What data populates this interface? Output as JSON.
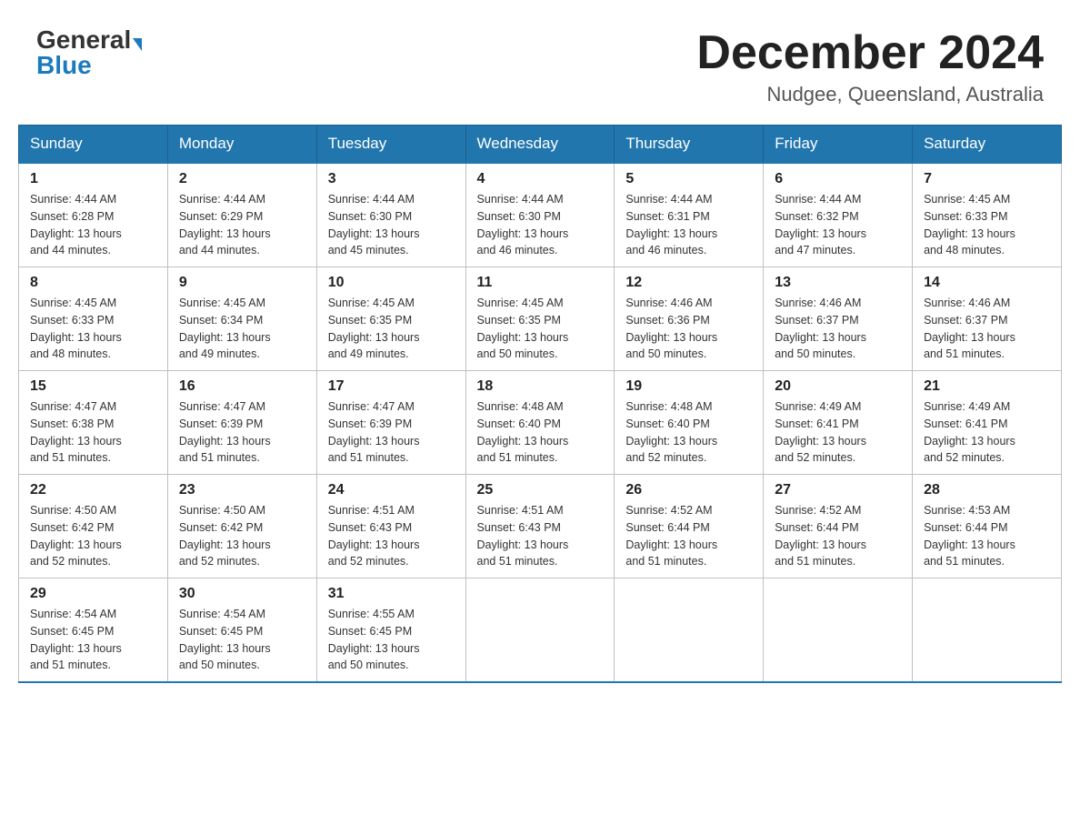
{
  "header": {
    "logo_general": "General",
    "logo_blue": "Blue",
    "month_title": "December 2024",
    "location": "Nudgee, Queensland, Australia"
  },
  "days_of_week": [
    "Sunday",
    "Monday",
    "Tuesday",
    "Wednesday",
    "Thursday",
    "Friday",
    "Saturday"
  ],
  "weeks": [
    [
      {
        "day": "1",
        "sunrise": "4:44 AM",
        "sunset": "6:28 PM",
        "daylight": "13 hours and 44 minutes."
      },
      {
        "day": "2",
        "sunrise": "4:44 AM",
        "sunset": "6:29 PM",
        "daylight": "13 hours and 44 minutes."
      },
      {
        "day": "3",
        "sunrise": "4:44 AM",
        "sunset": "6:30 PM",
        "daylight": "13 hours and 45 minutes."
      },
      {
        "day": "4",
        "sunrise": "4:44 AM",
        "sunset": "6:30 PM",
        "daylight": "13 hours and 46 minutes."
      },
      {
        "day": "5",
        "sunrise": "4:44 AM",
        "sunset": "6:31 PM",
        "daylight": "13 hours and 46 minutes."
      },
      {
        "day": "6",
        "sunrise": "4:44 AM",
        "sunset": "6:32 PM",
        "daylight": "13 hours and 47 minutes."
      },
      {
        "day": "7",
        "sunrise": "4:45 AM",
        "sunset": "6:33 PM",
        "daylight": "13 hours and 48 minutes."
      }
    ],
    [
      {
        "day": "8",
        "sunrise": "4:45 AM",
        "sunset": "6:33 PM",
        "daylight": "13 hours and 48 minutes."
      },
      {
        "day": "9",
        "sunrise": "4:45 AM",
        "sunset": "6:34 PM",
        "daylight": "13 hours and 49 minutes."
      },
      {
        "day": "10",
        "sunrise": "4:45 AM",
        "sunset": "6:35 PM",
        "daylight": "13 hours and 49 minutes."
      },
      {
        "day": "11",
        "sunrise": "4:45 AM",
        "sunset": "6:35 PM",
        "daylight": "13 hours and 50 minutes."
      },
      {
        "day": "12",
        "sunrise": "4:46 AM",
        "sunset": "6:36 PM",
        "daylight": "13 hours and 50 minutes."
      },
      {
        "day": "13",
        "sunrise": "4:46 AM",
        "sunset": "6:37 PM",
        "daylight": "13 hours and 50 minutes."
      },
      {
        "day": "14",
        "sunrise": "4:46 AM",
        "sunset": "6:37 PM",
        "daylight": "13 hours and 51 minutes."
      }
    ],
    [
      {
        "day": "15",
        "sunrise": "4:47 AM",
        "sunset": "6:38 PM",
        "daylight": "13 hours and 51 minutes."
      },
      {
        "day": "16",
        "sunrise": "4:47 AM",
        "sunset": "6:39 PM",
        "daylight": "13 hours and 51 minutes."
      },
      {
        "day": "17",
        "sunrise": "4:47 AM",
        "sunset": "6:39 PM",
        "daylight": "13 hours and 51 minutes."
      },
      {
        "day": "18",
        "sunrise": "4:48 AM",
        "sunset": "6:40 PM",
        "daylight": "13 hours and 51 minutes."
      },
      {
        "day": "19",
        "sunrise": "4:48 AM",
        "sunset": "6:40 PM",
        "daylight": "13 hours and 52 minutes."
      },
      {
        "day": "20",
        "sunrise": "4:49 AM",
        "sunset": "6:41 PM",
        "daylight": "13 hours and 52 minutes."
      },
      {
        "day": "21",
        "sunrise": "4:49 AM",
        "sunset": "6:41 PM",
        "daylight": "13 hours and 52 minutes."
      }
    ],
    [
      {
        "day": "22",
        "sunrise": "4:50 AM",
        "sunset": "6:42 PM",
        "daylight": "13 hours and 52 minutes."
      },
      {
        "day": "23",
        "sunrise": "4:50 AM",
        "sunset": "6:42 PM",
        "daylight": "13 hours and 52 minutes."
      },
      {
        "day": "24",
        "sunrise": "4:51 AM",
        "sunset": "6:43 PM",
        "daylight": "13 hours and 52 minutes."
      },
      {
        "day": "25",
        "sunrise": "4:51 AM",
        "sunset": "6:43 PM",
        "daylight": "13 hours and 51 minutes."
      },
      {
        "day": "26",
        "sunrise": "4:52 AM",
        "sunset": "6:44 PM",
        "daylight": "13 hours and 51 minutes."
      },
      {
        "day": "27",
        "sunrise": "4:52 AM",
        "sunset": "6:44 PM",
        "daylight": "13 hours and 51 minutes."
      },
      {
        "day": "28",
        "sunrise": "4:53 AM",
        "sunset": "6:44 PM",
        "daylight": "13 hours and 51 minutes."
      }
    ],
    [
      {
        "day": "29",
        "sunrise": "4:54 AM",
        "sunset": "6:45 PM",
        "daylight": "13 hours and 51 minutes."
      },
      {
        "day": "30",
        "sunrise": "4:54 AM",
        "sunset": "6:45 PM",
        "daylight": "13 hours and 50 minutes."
      },
      {
        "day": "31",
        "sunrise": "4:55 AM",
        "sunset": "6:45 PM",
        "daylight": "13 hours and 50 minutes."
      },
      null,
      null,
      null,
      null
    ]
  ],
  "labels": {
    "sunrise": "Sunrise:",
    "sunset": "Sunset:",
    "daylight": "Daylight:"
  }
}
